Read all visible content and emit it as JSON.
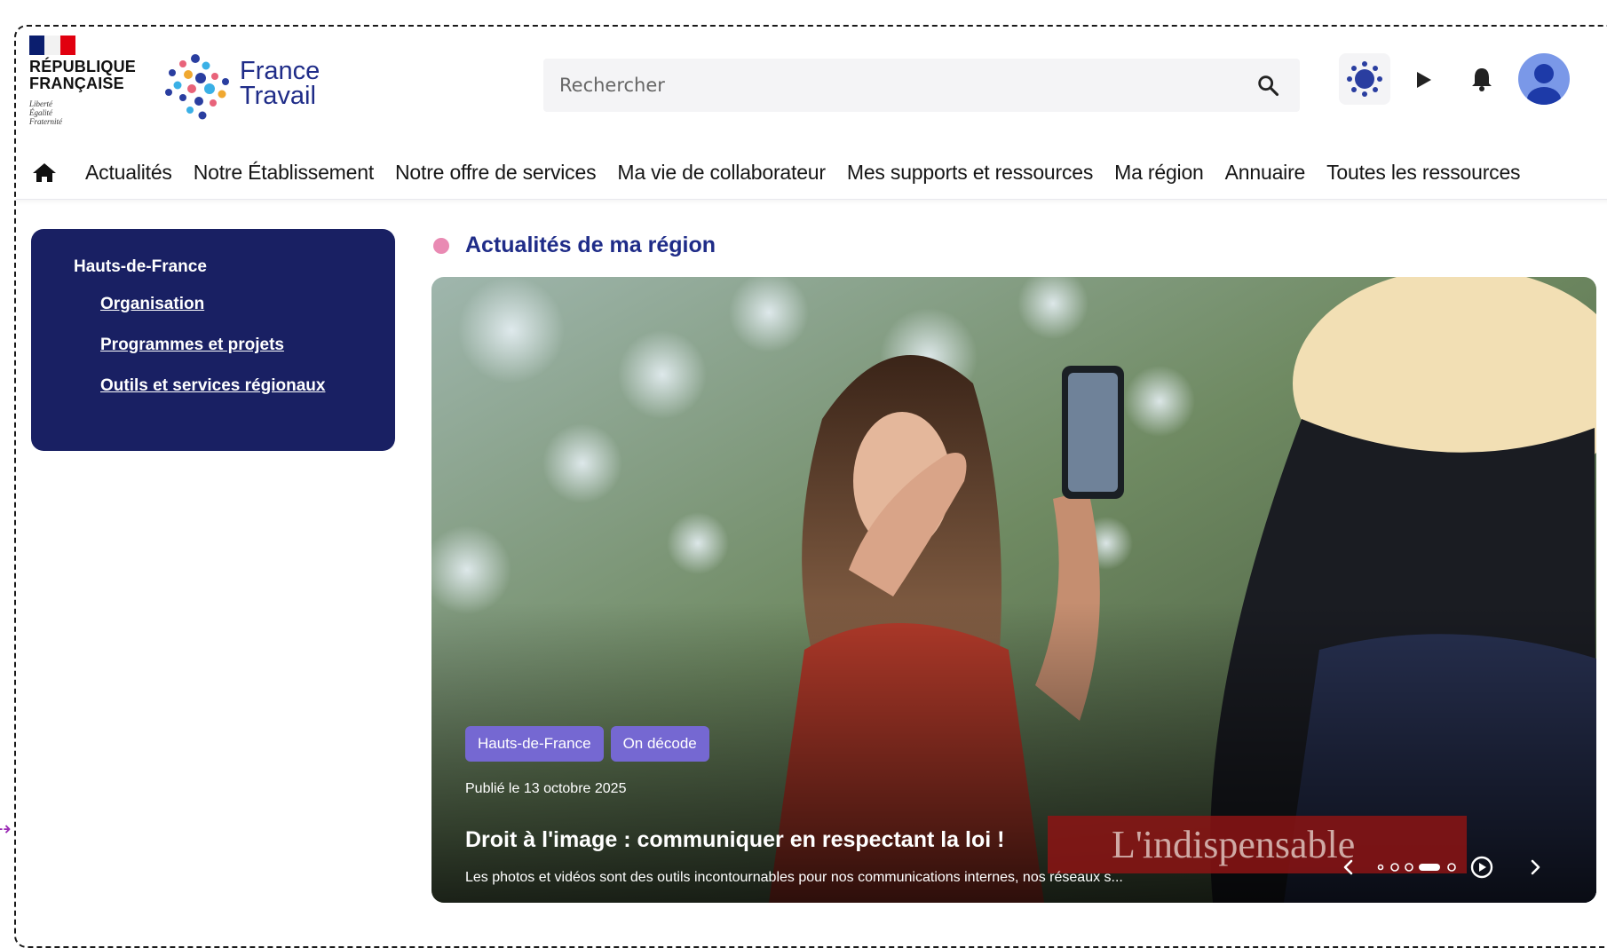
{
  "header": {
    "rf_name": "RÉPUBLIQUE FRANÇAISE",
    "rf_motto": [
      "Liberté",
      "Égalité",
      "Fraternité"
    ],
    "brand": "France Travail",
    "search_placeholder": "Rechercher"
  },
  "nav": {
    "items": [
      "Actualités",
      "Notre Établissement",
      "Notre offre de services",
      "Ma vie de collaborateur",
      "Mes supports et ressources",
      "Ma région",
      "Annuaire",
      "Toutes les ressources"
    ]
  },
  "sidebar": {
    "title": "Hauts-de-France",
    "links": [
      "Organisation",
      "Programmes et projets",
      "Outils et services régionaux"
    ]
  },
  "main": {
    "section_title": "Actualités de ma région",
    "hero": {
      "tags": [
        "Hauts-de-France",
        "On décode"
      ],
      "published": "Publié le 13 octobre 2025",
      "title": "Droit à l'image : communiquer en respectant la loi !",
      "description": "Les photos et vidéos sont des outils incontournables pour nos communications internes, nos réseaux s...",
      "overlay_text": "L'indispensable",
      "slides_total": 5,
      "active_slide": 4
    }
  },
  "colors": {
    "brand_blue": "#1f2c88",
    "sidebar_bg": "#192063",
    "tag_purple": "#7568d2",
    "accent_pink": "#e98ab3"
  }
}
